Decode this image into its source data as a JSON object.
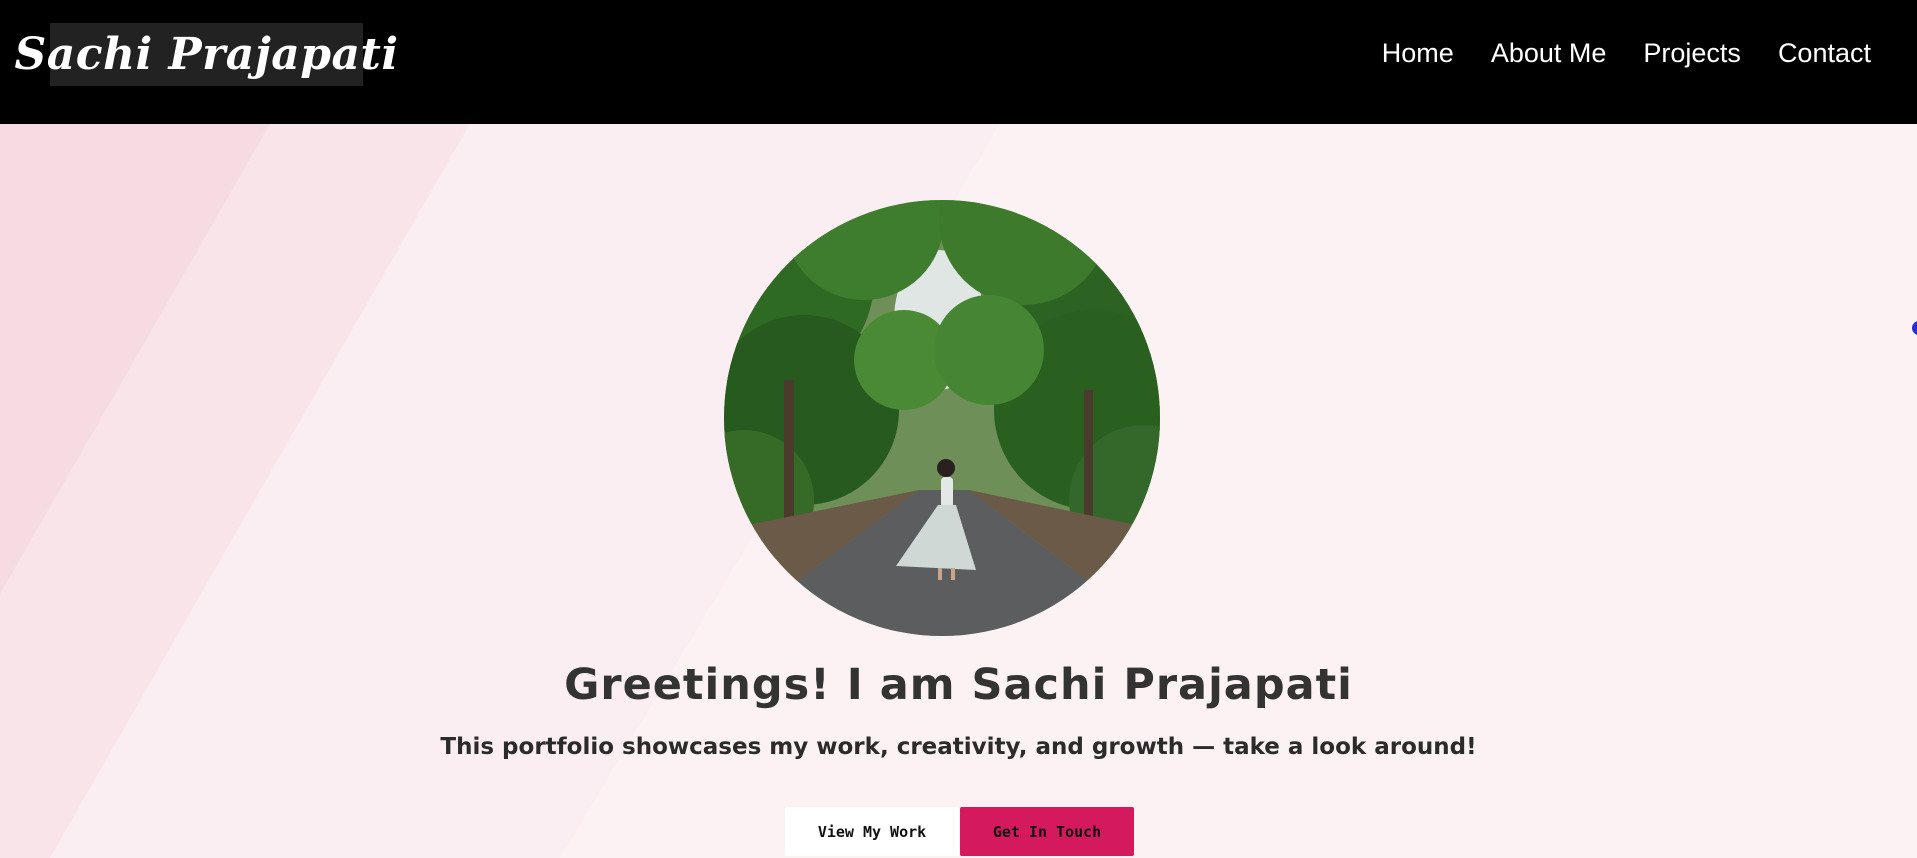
{
  "header": {
    "logo_text": "Sachi Prajapati",
    "nav": [
      "Home",
      "About Me",
      "Projects",
      "Contact"
    ]
  },
  "hero": {
    "photo_alt": "Sachi Prajapati",
    "headline": "Greetings! I am Sachi Prajapati",
    "subline": "This portfolio showcases my work, creativity, and growth — take a look around!",
    "buttons": {
      "view_work": "View My Work",
      "get_in_touch": "Get In Touch"
    }
  },
  "colors": {
    "header_bg": "#000000",
    "logo_bg": "#222222",
    "page_bg": "#fcf2f4",
    "accent": "#d4195e",
    "text_dark": "#333333"
  }
}
